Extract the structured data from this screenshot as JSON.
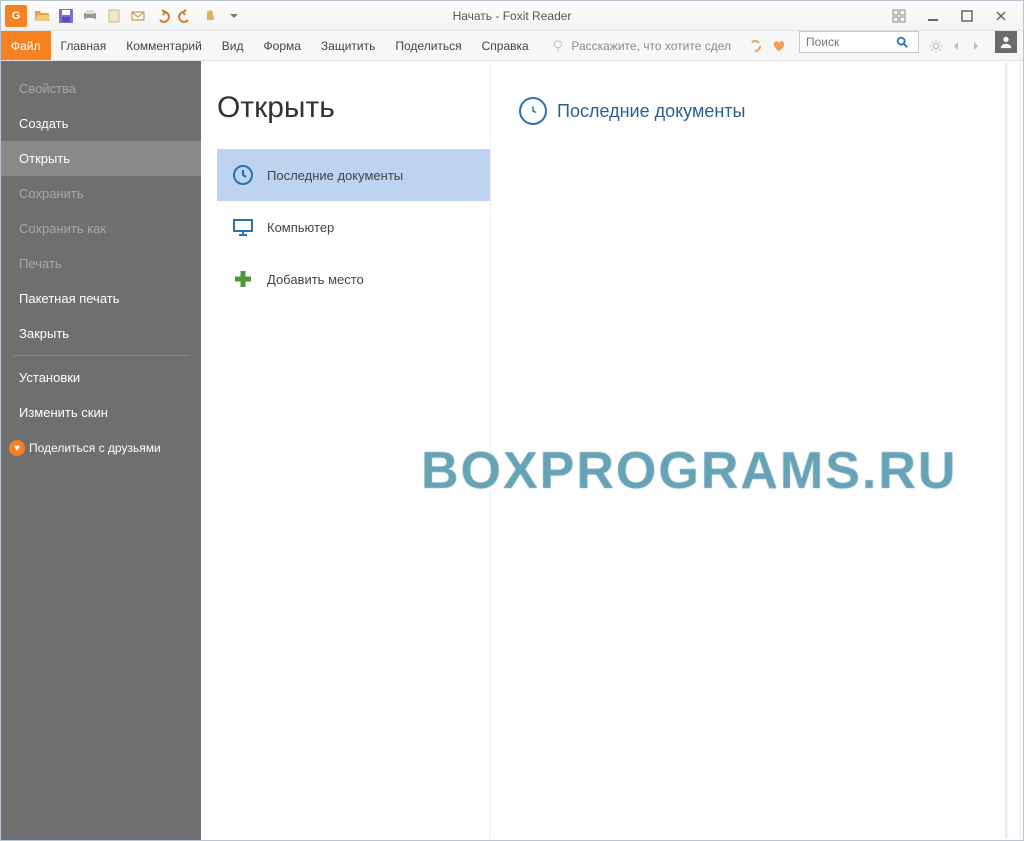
{
  "window": {
    "title": "Начать - Foxit Reader"
  },
  "ribbon": {
    "tabs": {
      "file": "Файл",
      "home": "Главная",
      "comment": "Комментарий",
      "view": "Вид",
      "form": "Форма",
      "protect": "Защитить",
      "share": "Поделиться",
      "help": "Справка"
    },
    "tell_me_placeholder": "Расскажите, что хотите сдел",
    "search_placeholder": "Поиск"
  },
  "sidebar": {
    "properties": "Свойства",
    "create": "Создать",
    "open": "Открыть",
    "save": "Сохранить",
    "save_as": "Сохранить как",
    "print": "Печать",
    "batch_print": "Пакетная печать",
    "close": "Закрыть",
    "preferences": "Установки",
    "change_skin": "Изменить скин",
    "share_friends": "Поделиться с друзьями"
  },
  "open_page": {
    "heading": "Открыть",
    "items": {
      "recent": "Последние документы",
      "computer": "Компьютер",
      "add_place": "Добавить место"
    },
    "recent_heading": "Последние документы"
  },
  "watermark": "BOXPROGRAMS.RU"
}
